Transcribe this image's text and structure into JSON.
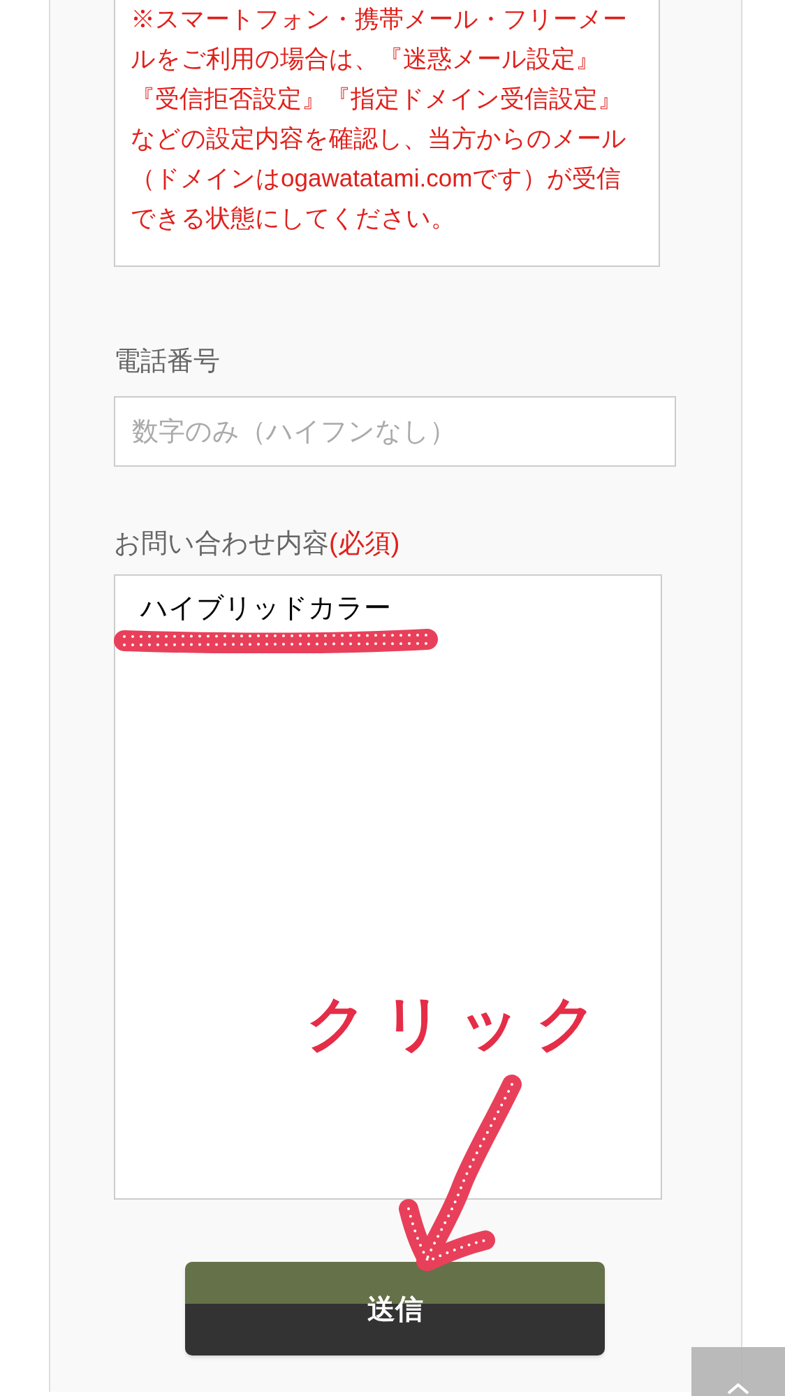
{
  "notice": "※スマートフォン・携帯メール・フリーメールをご利用の場合は、『迷惑メール設定』『受信拒否設定』『指定ドメイン受信設定』などの設定内容を確認し、当方からのメール（ドメインはogawatatami.comです）が受信できる状態にしてください。",
  "fields": [
    {
      "kind": "text",
      "label": "電話番号",
      "placeholder": "数字のみ（ハイフンなし）"
    },
    {
      "kind": "textarea",
      "label": "お問い合わせ内容",
      "required_mark": "(必須)",
      "value": "ハイブリッドカラー"
    }
  ],
  "submit_button": "送信",
  "annotation": {
    "text": "クリック"
  }
}
